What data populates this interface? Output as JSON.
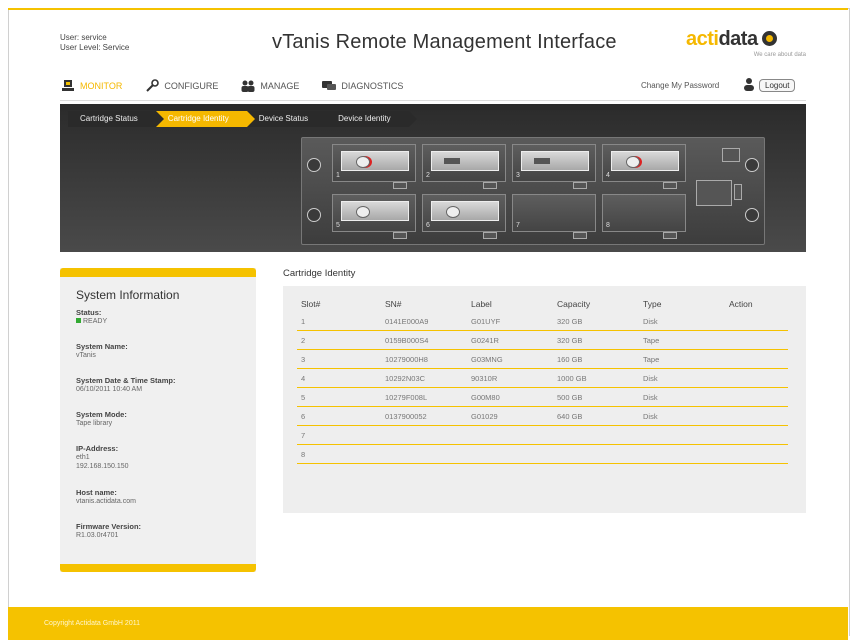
{
  "header": {
    "user_line": "User: service",
    "level_line": "User Level: Service",
    "title": "vTanis Remote Management Interface",
    "logo_a": "acti",
    "logo_b": "data",
    "logo_tagline": "We care about data"
  },
  "nav": {
    "items": [
      {
        "label": "MONITOR",
        "icon": "monitor-icon",
        "active": true
      },
      {
        "label": "CONFIGURE",
        "icon": "wrench-icon",
        "active": false
      },
      {
        "label": "MANAGE",
        "icon": "users-icon",
        "active": false
      },
      {
        "label": "DIAGNOSTICS",
        "icon": "chat-icon",
        "active": false
      }
    ],
    "change_password": "Change My Password",
    "logout": "Logout"
  },
  "breadcrumbs": [
    "Cartridge Status",
    "Cartridge Identity",
    "Device Status",
    "Device Identity"
  ],
  "chassis": {
    "slots": [
      {
        "num": "1",
        "content": "disk"
      },
      {
        "num": "2",
        "content": "tape"
      },
      {
        "num": "3",
        "content": "tape"
      },
      {
        "num": "4",
        "content": "disk"
      },
      {
        "num": "5",
        "content": "disk"
      },
      {
        "num": "6",
        "content": "disk"
      },
      {
        "num": "7",
        "content": "empty"
      },
      {
        "num": "8",
        "content": "empty"
      }
    ]
  },
  "sidebar": {
    "title": "System Information",
    "status_label": "Status:",
    "status_value": "READY",
    "system_name_label": "System Name:",
    "system_name_value": "vTanis",
    "datetime_label": "System Date & Time Stamp:",
    "datetime_value": "06/10/2011 10:40 AM",
    "mode_label": "System Mode:",
    "mode_value": "Tape library",
    "ip_label": "IP-Address:",
    "ip_iface": "eth1",
    "ip_value": "192.168.150.150",
    "host_label": "Host name:",
    "host_value": "vtanis.actidata.com",
    "fw_label": "Firmware Version:",
    "fw_value": "R1.03.0r4701"
  },
  "cartridge": {
    "title": "Cartridge Identity",
    "columns": [
      "Slot#",
      "SN#",
      "Label",
      "Capacity",
      "Type",
      "Action"
    ],
    "rows": [
      [
        "1",
        "0141E000A9",
        "G01UYF",
        "320 GB",
        "Disk",
        ""
      ],
      [
        "2",
        "0159B000S4",
        "G0241R",
        "320 GB",
        "Tape",
        ""
      ],
      [
        "3",
        "10279000H8",
        "G03MNG",
        "160 GB",
        "Tape",
        ""
      ],
      [
        "4",
        "10292N03C",
        "90310R",
        "1000 GB",
        "Disk",
        ""
      ],
      [
        "5",
        "10279F008L",
        "G00M80",
        "500 GB",
        "Disk",
        ""
      ],
      [
        "6",
        "0137900052",
        "G01029",
        "640 GB",
        "Disk",
        ""
      ],
      [
        "7",
        "",
        "",
        "",
        "",
        ""
      ],
      [
        "8",
        "",
        "",
        "",
        "",
        ""
      ]
    ]
  },
  "footer": {
    "copyright": "Copyright Actidata GmbH 2011"
  },
  "colors": {
    "accent": "#f5c200",
    "panel_dark": "#3a3a3a"
  }
}
